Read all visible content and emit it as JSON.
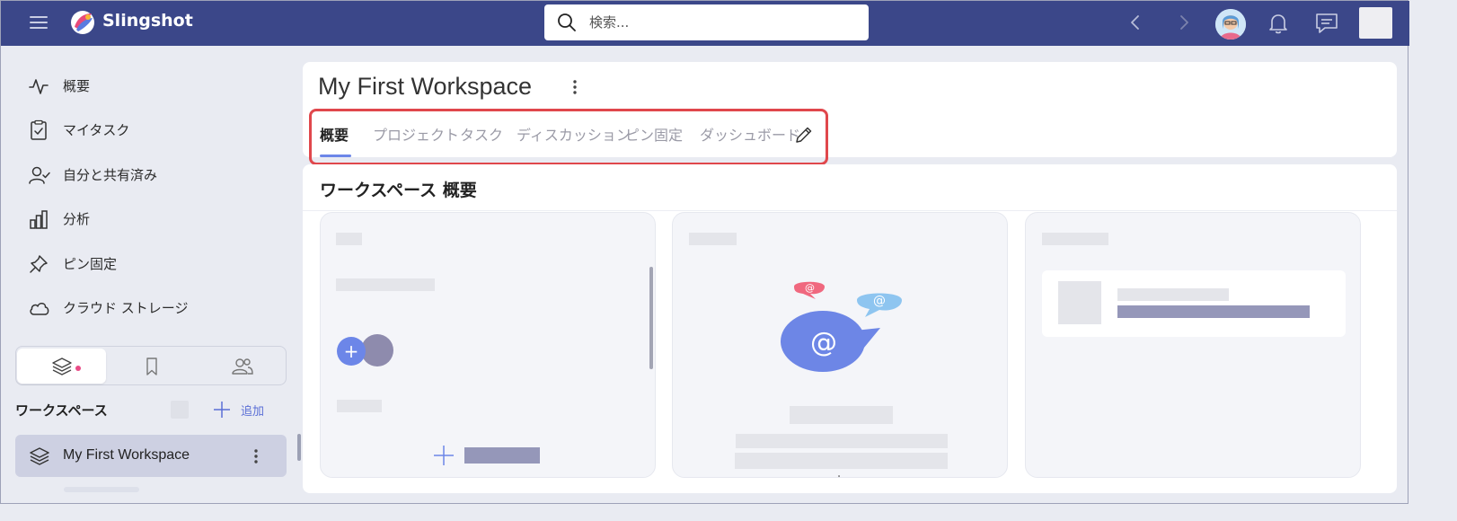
{
  "app": {
    "name": "Slingshot",
    "colors": {
      "topbar": "#3b4789",
      "accent": "#6c86e8",
      "highlight_outline": "#e0474c",
      "notification_dot": "#e94b86"
    }
  },
  "topbar": {
    "search_placeholder": "検索...",
    "icons": [
      "menu-icon",
      "logo-icon",
      "search-icon",
      "chevron-left-icon",
      "chevron-right-icon",
      "avatar",
      "bell-icon",
      "chat-icon"
    ]
  },
  "sidebar": {
    "items": [
      {
        "label": "概要",
        "icon": "activity-icon"
      },
      {
        "label": "マイタスク",
        "icon": "clipboard-check-icon"
      },
      {
        "label": "自分と共有済み",
        "icon": "user-check-icon"
      },
      {
        "label": "分析",
        "icon": "bar-chart-icon"
      },
      {
        "label": "ピン固定",
        "icon": "pin-icon"
      },
      {
        "label": "クラウド ストレージ",
        "icon": "cloud-icon"
      }
    ],
    "segments": [
      "layers-icon",
      "bookmark-icon",
      "users-icon"
    ],
    "workspaces_title": "ワークスペース",
    "add_label": "追加",
    "workspace_items": [
      {
        "label": "My First Workspace",
        "icon": "layers-icon"
      }
    ]
  },
  "main": {
    "title": "My First Workspace",
    "tabs": [
      {
        "label": "概要",
        "active": true
      },
      {
        "label": "プロジェクト",
        "active": false
      },
      {
        "label": "タスク",
        "active": false
      },
      {
        "label": "ディスカッション",
        "active": false
      },
      {
        "label": "ピン固定",
        "active": false
      },
      {
        "label": "ダッシュボード",
        "active": false
      }
    ],
    "section_title": "ワークスペース 概要",
    "cut_text": "ー+ー"
  }
}
